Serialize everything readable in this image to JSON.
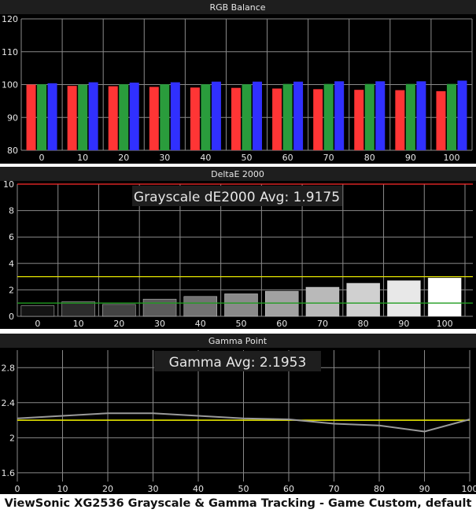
{
  "caption": "ViewSonic XG2536 Grayscale & Gamma Tracking - Game Custom, default",
  "colors": {
    "background": "#000000",
    "panel_title_bar": "#1e1e1e",
    "grid": "#8a8a8a",
    "text": "#e6e6e6",
    "red": "#ff3535",
    "green": "#2a9c3c",
    "blue": "#3030ff",
    "threshold_red": "#ff2a2a",
    "threshold_yellow": "#e6e600",
    "threshold_green": "#1f9c1f",
    "gamma_line": "#9a9a9a",
    "gamma_target": "#e6e600"
  },
  "chart_data": [
    {
      "type": "bar",
      "title": "RGB Balance",
      "categories": [
        "0",
        "10",
        "20",
        "30",
        "40",
        "50",
        "60",
        "70",
        "80",
        "90",
        "100"
      ],
      "series": [
        {
          "color": "red",
          "values": [
            100.0,
            99.6,
            99.5,
            99.3,
            99.1,
            99.0,
            98.8,
            98.6,
            98.4,
            98.3,
            98.0
          ]
        },
        {
          "color": "green",
          "values": [
            100.1,
            100.0,
            100.1,
            100.1,
            100.1,
            100.1,
            100.2,
            100.2,
            100.2,
            100.2,
            100.2
          ]
        },
        {
          "color": "blue",
          "values": [
            100.4,
            100.7,
            100.6,
            100.7,
            100.9,
            100.9,
            100.9,
            101.0,
            101.0,
            101.0,
            101.2
          ]
        }
      ],
      "ylim": [
        80,
        120
      ],
      "yticks": [
        "80",
        "90",
        "100",
        "110",
        "120"
      ],
      "grid": true
    },
    {
      "type": "bar",
      "title": "DeltaE 2000",
      "annotation": "Grayscale dE2000 Avg: 1.9175",
      "categories": [
        "0",
        "10",
        "20",
        "30",
        "40",
        "50",
        "60",
        "70",
        "80",
        "90",
        "100"
      ],
      "values": [
        0.8,
        1.1,
        0.9,
        1.3,
        1.5,
        1.7,
        1.9,
        2.2,
        2.5,
        2.7,
        2.9
      ],
      "thresholds": [
        {
          "value": 10,
          "color": "threshold_red"
        },
        {
          "value": 3,
          "color": "threshold_yellow"
        },
        {
          "value": 1,
          "color": "threshold_green"
        }
      ],
      "ylim": [
        0,
        10
      ],
      "yticks": [
        "0",
        "2",
        "4",
        "6",
        "8",
        "10"
      ],
      "grid": true
    },
    {
      "type": "line",
      "title": "Gamma Point",
      "annotation": "Gamma Avg: 2.1953",
      "x": [
        0,
        10,
        20,
        30,
        40,
        50,
        60,
        70,
        80,
        90,
        100
      ],
      "y": [
        2.22,
        2.25,
        2.28,
        2.28,
        2.25,
        2.22,
        2.21,
        2.16,
        2.14,
        2.07,
        2.21
      ],
      "target": 2.2,
      "xticks": [
        "0",
        "10",
        "20",
        "30",
        "40",
        "50",
        "60",
        "70",
        "80",
        "90",
        "100"
      ],
      "yticks": [
        "1.6",
        "2",
        "2.4",
        "2.8"
      ],
      "xlim": [
        0,
        100
      ],
      "ylim": [
        1.5,
        3.0
      ],
      "grid": true
    }
  ]
}
